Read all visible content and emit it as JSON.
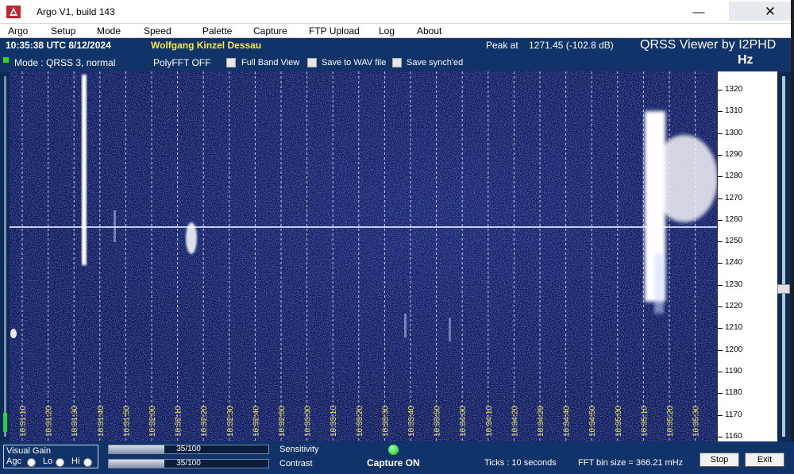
{
  "window": {
    "title": "Argo V1, build 143",
    "minimize_glyph": "—",
    "close_glyph": "✕",
    "icon": "argo-app-icon"
  },
  "menu": [
    "Argo",
    "Setup",
    "Mode",
    "Speed",
    "Palette",
    "Capture",
    "FTP Upload",
    "Log",
    "About"
  ],
  "info": {
    "clock": "10:35:38 UTC  8/12/2024",
    "callsign": "Wolfgang Kinzel Dessau",
    "peak_label": "Peak at",
    "peak_value": "1271.45 (-102.8 dB)",
    "brand": "QRSS Viewer by I2PHD",
    "unit": "Hz"
  },
  "mode_bar": {
    "mode": "Mode : QRSS 3, normal",
    "polyfft": "PolyFFT OFF",
    "checkboxes": [
      {
        "label": "Full Band View",
        "checked": false
      },
      {
        "label": "Save to WAV file",
        "checked": false
      },
      {
        "label": "Save synch'ed",
        "checked": false
      }
    ]
  },
  "waterfall": {
    "background_color": "#091552",
    "signal_color": "#ffffff",
    "time_labels": [
      "10:31:10",
      "10:31:20",
      "10:31:30",
      "10:31:40",
      "10:31:50",
      "10:32:00",
      "10:32:10",
      "10:32:20",
      "10:32:30",
      "10:32:40",
      "10:32:50",
      "10:33:00",
      "10:33:10",
      "10:33:20",
      "10:33:30",
      "10:33:40",
      "10:33:50",
      "10:34:00",
      "10:34:10",
      "10:34:20",
      "10:34:29",
      "10:34:40",
      "10:34:50",
      "10:35:00",
      "10:35:10",
      "10:35:20",
      "10:35:30"
    ],
    "carrier_freq_hz": 1257
  },
  "freq_axis": {
    "labels": [
      "1320",
      "1310",
      "1300",
      "1290",
      "1280",
      "1270",
      "1260",
      "1250",
      "1240",
      "1230",
      "1220",
      "1210",
      "1200",
      "1190",
      "1180",
      "1170",
      "1160"
    ]
  },
  "bottom": {
    "visual_gain_title": "Visual Gain",
    "gain_options": [
      {
        "label": "Agc",
        "selected": false
      },
      {
        "label": "Lo",
        "selected": false
      },
      {
        "label": "Hi",
        "selected": false
      }
    ],
    "sensitivity": {
      "label": "Sensitivity",
      "value_text": "35/100",
      "fraction": 0.35
    },
    "contrast": {
      "label": "Contrast",
      "value_text": "35/100",
      "fraction": 0.35
    },
    "capture_text": "Capture ON",
    "ticks_text": "Ticks  :  10 seconds",
    "fft_bin_text": "FFT bin size = 366.21 mHz",
    "stop_label": "Stop",
    "exit_label": "Exit"
  }
}
